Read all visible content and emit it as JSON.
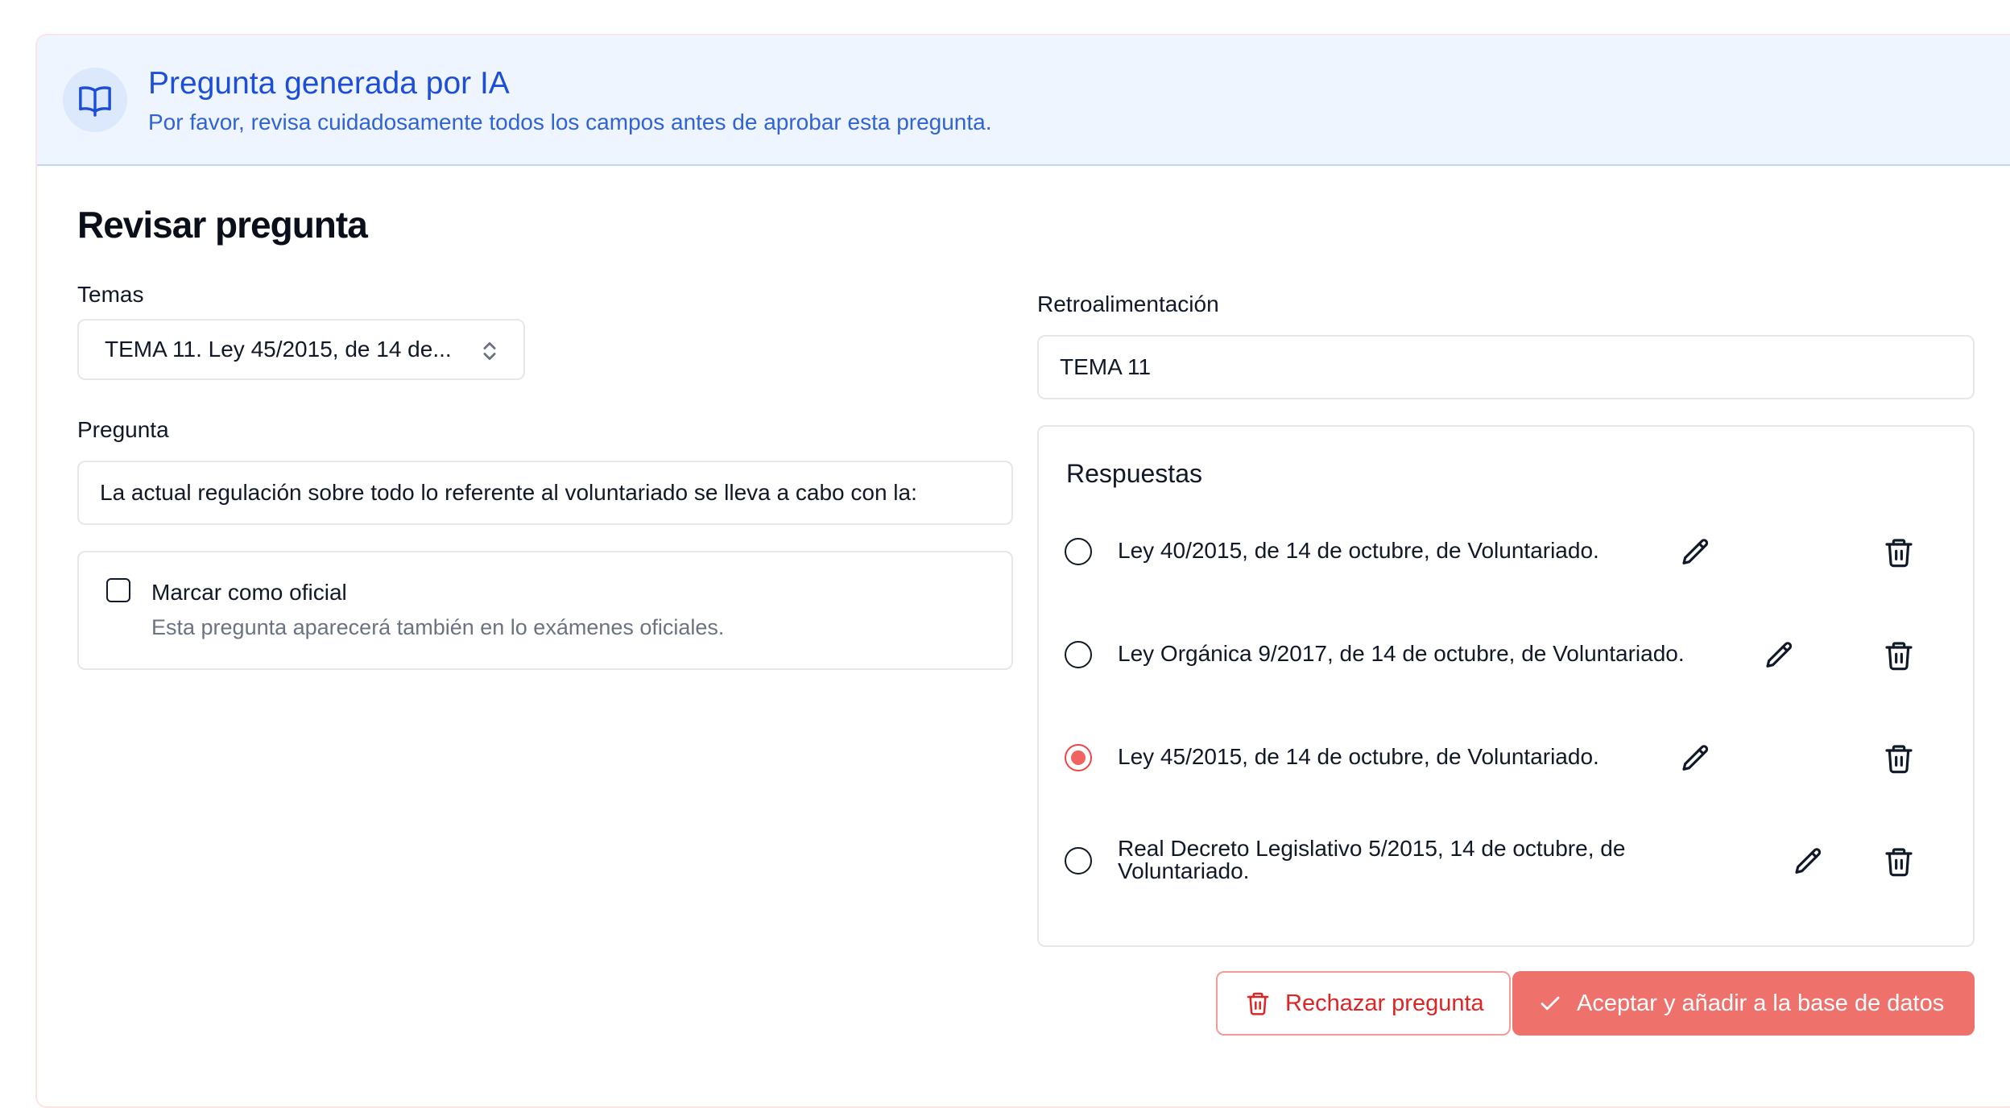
{
  "banner": {
    "title": "Pregunta generada por IA",
    "subtitle": "Por favor, revisa cuidadosamente todos los campos antes de aprobar esta pregunta.",
    "icon": "open-book-icon"
  },
  "page_title": "Revisar pregunta",
  "temas": {
    "label": "Temas",
    "selected": "TEMA 11. Ley 45/2015, de 14 de..."
  },
  "pregunta": {
    "label": "Pregunta",
    "value": "La actual regulación sobre todo lo referente al voluntariado se lleva a cabo con la:"
  },
  "oficial": {
    "label": "Marcar como oficial",
    "description": "Esta pregunta aparecerá también en lo exámenes oficiales.",
    "checked": false
  },
  "retroalimentacion": {
    "label": "Retroalimentación",
    "value": "TEMA 11"
  },
  "respuestas": {
    "title": "Respuestas",
    "items": [
      {
        "line1": "Ley 40/2015, de 14 de octubre, de Voluntariado.",
        "line2": "",
        "selected": false
      },
      {
        "line1": "Ley Orgánica 9/2017, de 14 de octubre, de Voluntariado.",
        "line2": "",
        "selected": false
      },
      {
        "line1": "Ley 45/2015, de 14 de octubre, de Voluntariado.",
        "line2": "",
        "selected": true
      },
      {
        "line1": "Real Decreto Legislativo 5/2015, 14 de octubre, de",
        "line2": "Voluntariado.",
        "selected": false
      }
    ]
  },
  "actions": {
    "reject_label": "Rechazar pregunta",
    "accept_label": "Aceptar y añadir a la base de datos"
  },
  "colors": {
    "accent_blue": "#1d4ed8",
    "accept_bg": "#ee716c",
    "reject_text": "#dc2626",
    "radio_selected": "#ef6461"
  }
}
